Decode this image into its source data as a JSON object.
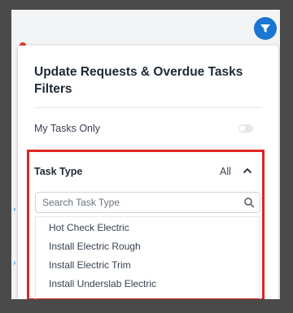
{
  "panel": {
    "title": "Update Requests & Overdue Tasks Filters",
    "my_tasks_label": "My Tasks Only",
    "my_tasks_enabled": false
  },
  "task_type": {
    "label": "Task Type",
    "selected_value": "All",
    "search_placeholder": "Search Task Type",
    "search_value": "",
    "options": [
      "Hot Check Electric",
      "Install Electric Rough",
      "Install Electric Trim",
      "Install Underslab Electric"
    ]
  },
  "colors": {
    "accent": "#1976d2",
    "highlight": "#e02424"
  },
  "icons": {
    "filter_button": "filter-icon",
    "collapse": "chevron-up-icon",
    "search": "search-icon"
  }
}
